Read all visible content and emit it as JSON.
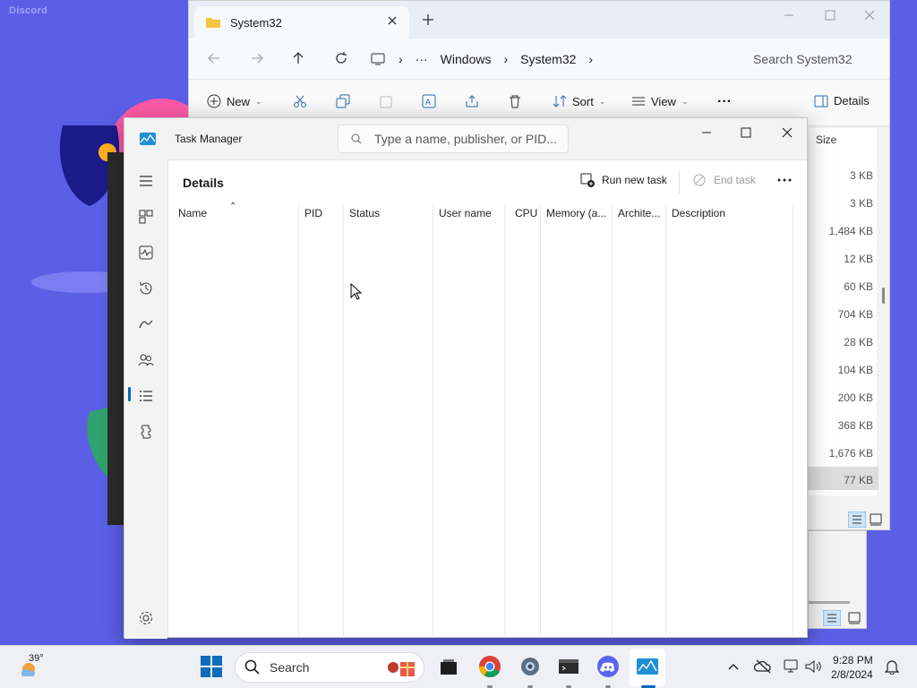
{
  "desktop": {
    "watermark": "Discord"
  },
  "explorer": {
    "tab_title": "System32",
    "breadcrumbs": [
      "Windows",
      "System32"
    ],
    "search_placeholder": "Search System32",
    "toolbar": {
      "new": "New",
      "sort": "Sort",
      "view": "View",
      "details": "Details"
    },
    "size_header": "Size",
    "sizes": [
      "3 KB",
      "3 KB",
      "1,484 KB",
      "12 KB",
      "60 KB",
      "704 KB",
      "28 KB",
      "104 KB",
      "200 KB",
      "368 KB",
      "1,676 KB",
      "77 KB"
    ]
  },
  "task_manager": {
    "title": "Task Manager",
    "search_placeholder": "Type a name, publisher, or PID...",
    "page_title": "Details",
    "run_new_task": "Run new task",
    "end_task": "End task",
    "columns": [
      "Name",
      "PID",
      "Status",
      "User name",
      "CPU",
      "Memory (a...",
      "Archite...",
      "Description"
    ],
    "active_nav": "details-icon"
  },
  "taskbar": {
    "weather_temp": "39°",
    "search_label": "Search",
    "time": "9:28 PM",
    "date": "2/8/2024"
  },
  "colors": {
    "desktop": "#5b5fe6",
    "accent": "#0067c0",
    "taskbar": "#eef0f4"
  }
}
